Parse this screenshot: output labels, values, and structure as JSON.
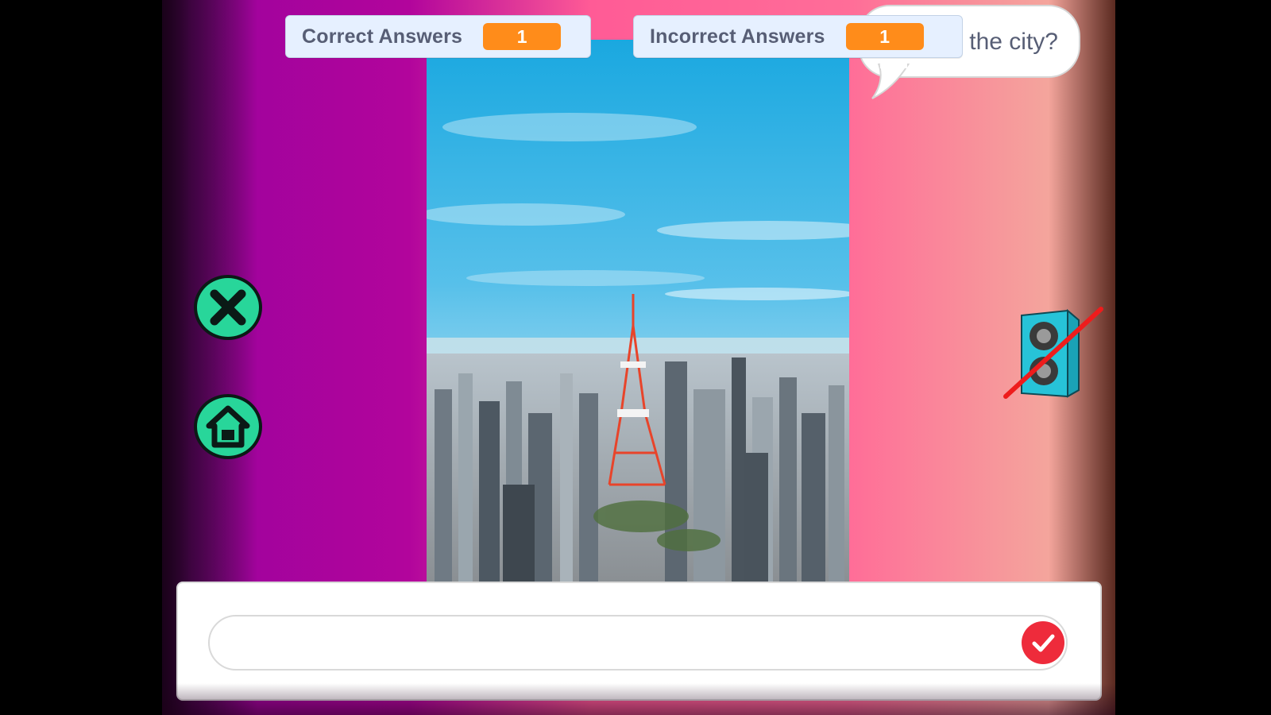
{
  "monitors": {
    "correct": {
      "label": "Correct Answers",
      "value": "1"
    },
    "incorrect": {
      "label": "Incorrect Answers",
      "value": "1"
    }
  },
  "speech_bubble": {
    "text": "the city?"
  },
  "answer_prompt": {
    "value": "",
    "placeholder": ""
  },
  "icons": {
    "close": "close-icon",
    "home": "home-icon",
    "speaker_muted": "speaker-muted-icon",
    "submit": "checkmark-icon"
  },
  "colors": {
    "monitor_bg": "#e6f0ff",
    "monitor_value": "#ff8c1a",
    "button_green": "#28d69a",
    "submit_red": "#ee2b3b",
    "speaker_cyan": "#27c3d8",
    "mute_line": "#ee1c1c"
  }
}
